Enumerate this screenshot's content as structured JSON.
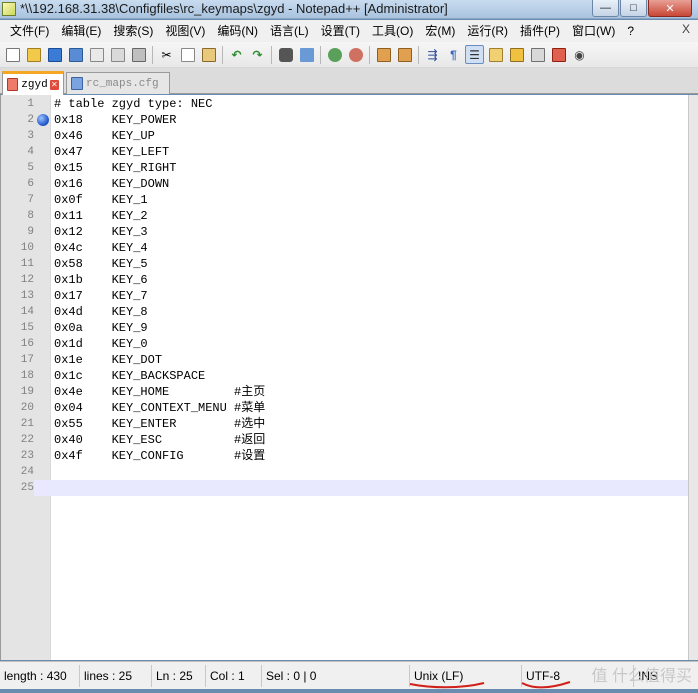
{
  "window": {
    "title": "*\\\\192.168.31.38\\Configfiles\\rc_keymaps\\zgyd - Notepad++ [Administrator]",
    "minimize_label": "—",
    "maximize_label": "□",
    "close_label": "✕"
  },
  "menu": {
    "items": [
      {
        "label": "文件(F)"
      },
      {
        "label": "编辑(E)"
      },
      {
        "label": "搜索(S)"
      },
      {
        "label": "视图(V)"
      },
      {
        "label": "编码(N)"
      },
      {
        "label": "语言(L)"
      },
      {
        "label": "设置(T)"
      },
      {
        "label": "工具(O)"
      },
      {
        "label": "宏(M)"
      },
      {
        "label": "运行(R)"
      },
      {
        "label": "插件(P)"
      },
      {
        "label": "窗口(W)"
      },
      {
        "label": "?"
      }
    ],
    "close_label": "X"
  },
  "toolbar": {
    "icons": [
      "new-file-icon",
      "open-file-icon",
      "save-icon",
      "save-all-icon",
      "close-icon",
      "close-all-icon",
      "print-icon",
      "cut-icon",
      "copy-icon",
      "paste-icon",
      "undo-icon",
      "redo-icon",
      "find-icon",
      "replace-icon",
      "zoom-in-icon",
      "zoom-out-icon",
      "sync-vertical-icon",
      "sync-horizontal-icon",
      "word-wrap-icon",
      "show-all-chars-icon",
      "indent-guide-icon",
      "doc-map-icon",
      "function-list-icon",
      "folder-workspace-icon",
      "monitoring-icon",
      "macro-record-icon"
    ]
  },
  "tabs": [
    {
      "label": "zgyd",
      "active": true
    },
    {
      "label": "rc_maps.cfg",
      "active": false
    }
  ],
  "editor": {
    "current_line": 25,
    "bookmark_line": 2,
    "lines": [
      {
        "n": "1",
        "text": "# table zgyd type: NEC"
      },
      {
        "n": "2",
        "text": "0x18    KEY_POWER"
      },
      {
        "n": "3",
        "text": "0x46    KEY_UP"
      },
      {
        "n": "4",
        "text": "0x47    KEY_LEFT"
      },
      {
        "n": "5",
        "text": "0x15    KEY_RIGHT"
      },
      {
        "n": "6",
        "text": "0x16    KEY_DOWN"
      },
      {
        "n": "7",
        "text": "0x0f    KEY_1"
      },
      {
        "n": "8",
        "text": "0x11    KEY_2"
      },
      {
        "n": "9",
        "text": "0x12    KEY_3"
      },
      {
        "n": "10",
        "text": "0x4c    KEY_4"
      },
      {
        "n": "11",
        "text": "0x58    KEY_5"
      },
      {
        "n": "12",
        "text": "0x1b    KEY_6"
      },
      {
        "n": "13",
        "text": "0x17    KEY_7"
      },
      {
        "n": "14",
        "text": "0x4d    KEY_8"
      },
      {
        "n": "15",
        "text": "0x0a    KEY_9"
      },
      {
        "n": "16",
        "text": "0x1d    KEY_0"
      },
      {
        "n": "17",
        "text": "0x1e    KEY_DOT"
      },
      {
        "n": "18",
        "text": "0x1c    KEY_BACKSPACE"
      },
      {
        "n": "19",
        "text": "0x4e    KEY_HOME         #主页"
      },
      {
        "n": "20",
        "text": "0x04    KEY_CONTEXT_MENU #菜单"
      },
      {
        "n": "21",
        "text": "0x55    KEY_ENTER        #选中"
      },
      {
        "n": "22",
        "text": "0x40    KEY_ESC          #返回"
      },
      {
        "n": "23",
        "text": "0x4f    KEY_CONFIG       #设置"
      },
      {
        "n": "24",
        "text": ""
      },
      {
        "n": "25",
        "text": ""
      }
    ]
  },
  "status": {
    "length": "length : 430",
    "lines": "lines : 25",
    "ln": "Ln : 25",
    "col": "Col : 1",
    "sel": "Sel : 0 | 0",
    "eol": "Unix (LF)",
    "encoding": "UTF-8",
    "mode": "INS"
  },
  "watermark": "值 什么值得买",
  "colors": {
    "title_bar": "#b9d1ea",
    "active_tab_accent": "#f5a623",
    "current_line": "#e8e8ff",
    "bookmark": "#2a5fd0",
    "annotation_red": "#d0201a"
  }
}
